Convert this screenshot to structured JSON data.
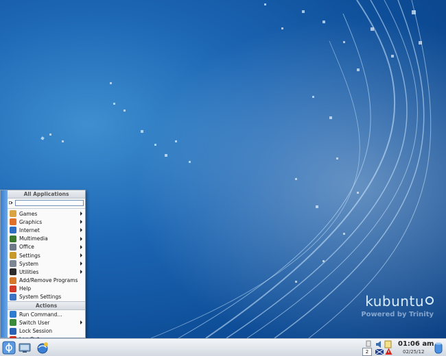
{
  "wallpaper": {
    "brand_name": "kubuntu",
    "brand_sub": "Powered by Trinity"
  },
  "menu": {
    "header": "All Applications",
    "search_value": "",
    "items": [
      {
        "label": "Games",
        "icon": "games-icon",
        "submenu": true,
        "color": "#d9a441"
      },
      {
        "label": "Graphics",
        "icon": "graphics-icon",
        "submenu": true,
        "color": "#e0702a"
      },
      {
        "label": "Internet",
        "icon": "internet-icon",
        "submenu": true,
        "color": "#2f6fc2"
      },
      {
        "label": "Multimedia",
        "icon": "multimedia-icon",
        "submenu": true,
        "color": "#3c7a2e"
      },
      {
        "label": "Office",
        "icon": "office-icon",
        "submenu": true,
        "color": "#6e7a88"
      },
      {
        "label": "Settings",
        "icon": "settings-icon",
        "submenu": true,
        "color": "#c89a2a"
      },
      {
        "label": "System",
        "icon": "system-icon",
        "submenu": true,
        "color": "#7d8794"
      },
      {
        "label": "Utilities",
        "icon": "utilities-icon",
        "submenu": true,
        "color": "#2b2b2b"
      },
      {
        "label": "Add/Remove Programs",
        "icon": "add-remove-programs-icon",
        "submenu": false,
        "color": "#d6782a"
      },
      {
        "label": "Help",
        "icon": "help-icon",
        "submenu": false,
        "color": "#d23a2a"
      },
      {
        "label": "System Settings",
        "icon": "system-settings-icon",
        "submenu": false,
        "color": "#3b74c4"
      }
    ],
    "actions_header": "Actions",
    "actions": [
      {
        "label": "Run Command...",
        "icon": "run-command-icon",
        "submenu": false,
        "color": "#2f7dd0"
      },
      {
        "label": "Switch User",
        "icon": "switch-user-icon",
        "submenu": true,
        "color": "#3c8a3c"
      },
      {
        "label": "Lock Session",
        "icon": "lock-session-icon",
        "submenu": false,
        "color": "#2a62b8"
      },
      {
        "label": "Log Out...",
        "icon": "log-out-icon",
        "submenu": false,
        "color": "#cc3322"
      }
    ]
  },
  "taskbar": {
    "desktop_number": "2",
    "clock_time": "01:06 am",
    "clock_date": "02/25/12"
  }
}
